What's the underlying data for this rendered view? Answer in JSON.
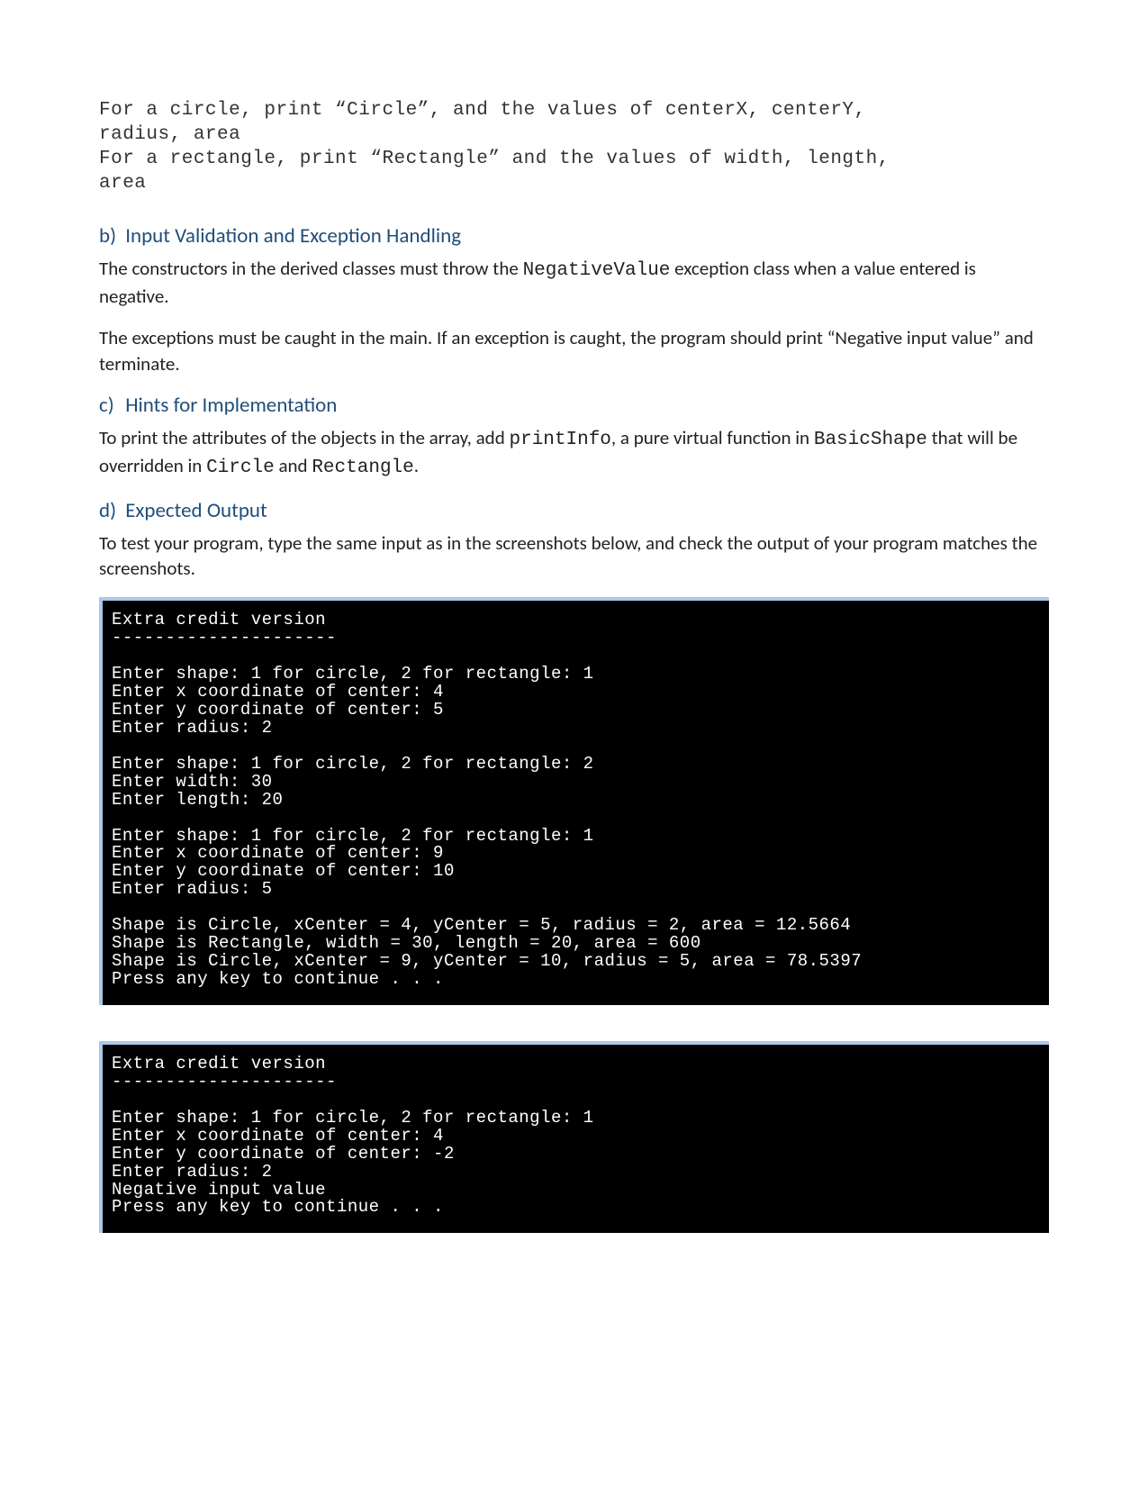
{
  "intro_block": "For a circle, print “Circle”, and the values of centerX, centerY,\nradius, area\nFor a rectangle, print “Rectangle” and the values of width, length,\narea",
  "sections": {
    "b": {
      "letter": "b)",
      "title": "Input Validation and Exception Handling",
      "para1_pre": "The constructors in the derived classes must throw the ",
      "para1_code": "NegativeValue",
      "para1_post": " exception class when a value entered is negative.",
      "para2": "The exceptions must be caught in the main. If an exception is caught, the program should print “Negative input value” and terminate."
    },
    "c": {
      "letter": "c)",
      "title": "Hints for Implementation",
      "p_pre": "To print the attributes of the objects in the array, add ",
      "p_c1": "printInfo",
      "p_mid1": ", a pure virtual function in ",
      "p_c2": "BasicShape",
      "p_mid2": " that will be overridden in ",
      "p_c3": "Circle",
      "p_mid3": " and ",
      "p_c4": "Rectangle",
      "p_post": "."
    },
    "d": {
      "letter": "d)",
      "title": "Expected Output",
      "para": "To test your program, type the same input as in the screenshots below, and check the output of your program matches the screenshots."
    }
  },
  "terminal1": "Extra credit version\n---------------------\n\nEnter shape: 1 for circle, 2 for rectangle: 1\nEnter x coordinate of center: 4\nEnter y coordinate of center: 5\nEnter radius: 2\n\nEnter shape: 1 for circle, 2 for rectangle: 2\nEnter width: 30\nEnter length: 20\n\nEnter shape: 1 for circle, 2 for rectangle: 1\nEnter x coordinate of center: 9\nEnter y coordinate of center: 10\nEnter radius: 5\n\nShape is Circle, xCenter = 4, yCenter = 5, radius = 2, area = 12.5664\nShape is Rectangle, width = 30, length = 20, area = 600\nShape is Circle, xCenter = 9, yCenter = 10, radius = 5, area = 78.5397\nPress any key to continue . . .",
  "terminal2": "Extra credit version\n---------------------\n\nEnter shape: 1 for circle, 2 for rectangle: 1\nEnter x coordinate of center: 4\nEnter y coordinate of center: -2\nEnter radius: 2\nNegative input value\nPress any key to continue . . ."
}
